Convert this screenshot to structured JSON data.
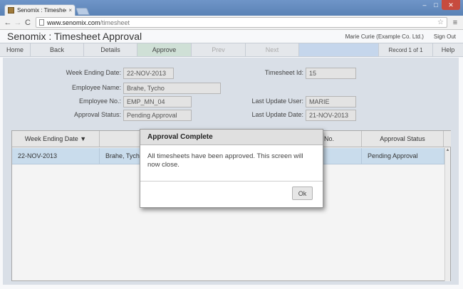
{
  "browser": {
    "tab_title": "Senomix : Timesheet Appr",
    "tab_close": "×",
    "url_host": "www.senomix.com",
    "url_path": "/timesheet",
    "back": "←",
    "forward": "→",
    "reload": "C",
    "star": "☆",
    "menu": "≡",
    "minimize": "–",
    "maximize": "□",
    "close": "✕"
  },
  "app": {
    "title": "Senomix : Timesheet Approval",
    "user": "Marie Curie  (Example Co. Ltd.)",
    "sign_out": "Sign Out"
  },
  "menu": {
    "home": "Home",
    "back": "Back",
    "details": "Details",
    "approve": "Approve",
    "prev": "Prev",
    "next": "Next",
    "record": "Record 1 of 1",
    "help": "Help"
  },
  "form": {
    "week_ending_label": "Week Ending Date:",
    "week_ending_value": "22-NOV-2013",
    "employee_name_label": "Employee Name:",
    "employee_name_value": "Brahe, Tycho",
    "employee_no_label": "Employee No.:",
    "employee_no_value": "EMP_MN_04",
    "approval_status_label": "Approval Status:",
    "approval_status_value": "Pending Approval",
    "timesheet_id_label": "Timesheet Id:",
    "timesheet_id_value": "15",
    "last_update_user_label": "Last Update User:",
    "last_update_user_value": "MARIE",
    "last_update_date_label": "Last Update Date:",
    "last_update_date_value": "21-NOV-2013"
  },
  "grid": {
    "headers": [
      "Week Ending Date ▼",
      "",
      "No.",
      "Approval Status"
    ],
    "rows": [
      [
        "22-NOV-2013",
        "Brahe, Tycho",
        "",
        "Pending Approval"
      ]
    ],
    "scroll_up": "▲"
  },
  "modal": {
    "title": "Approval Complete",
    "message": "All timesheets have been approved. This screen will now close.",
    "ok": "Ok"
  }
}
